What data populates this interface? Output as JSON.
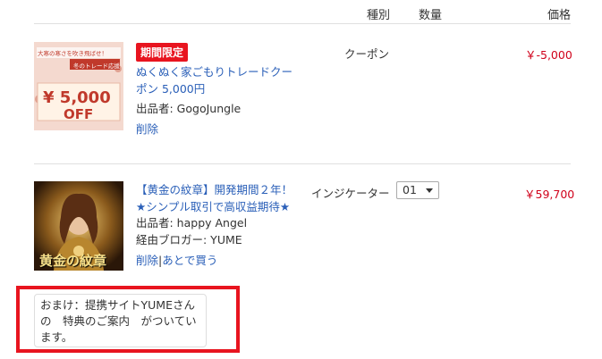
{
  "header": {
    "type_label": "種別",
    "qty_label": "数量",
    "price_label": "価格"
  },
  "items": [
    {
      "thumb": {
        "banner_text": "大寒の寒さを吹き飛ばせ！",
        "tag_text": "冬のトレード応援",
        "amount": "¥ 5,000",
        "off": "OFF",
        "icon": "coupon-ticket-icon",
        "colors": {
          "bg": "#f4d9cf",
          "ticket": "#fff3e6",
          "text": "#c0392b"
        }
      },
      "badge": "期間限定",
      "title_lines": [
        "ぬくぬく家ごもりトレードクー",
        "ポン 5,000円"
      ],
      "seller": "出品者: GogoJungle",
      "actions": [
        "削除"
      ],
      "type": "クーポン",
      "price": "￥-5,000"
    },
    {
      "thumb": {
        "caption": "黄金の紋章",
        "icon": "golden-warrior-portrait",
        "colors": {
          "bg": "#3a2410",
          "gold": "#d4a437"
        }
      },
      "title_lines": [
        "【黄金の紋章】開発期間２年！",
        "★シンプル取引で高収益期待★"
      ],
      "seller": "出品者: happy Angel",
      "blogger": "経由ブロガー: YUME",
      "actions": [
        "削除",
        "|",
        "あとで買う"
      ],
      "type": "インジケーター",
      "qty": "01",
      "price": "￥59,700"
    }
  ],
  "bonus": {
    "lines": [
      "おまけ：提携サイトYUMEさん",
      "の　特典のご案内　がついてい",
      "ます。"
    ]
  },
  "colors": {
    "price": "#d0021b",
    "link": "#2a5fb8",
    "highlight": "#e8141f"
  }
}
